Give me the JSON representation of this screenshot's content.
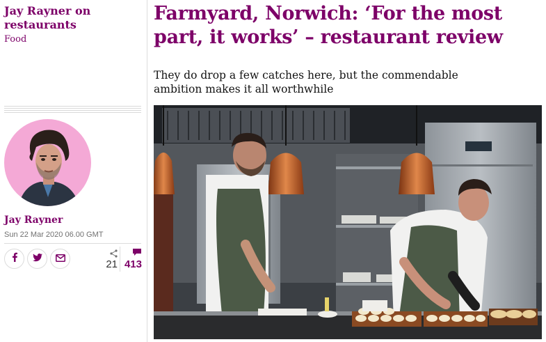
{
  "series": {
    "title": "Jay Rayner on restaurants",
    "section": "Food"
  },
  "byline": {
    "name": "Jay Rayner",
    "date": "Sun 22 Mar 2020 06.00 GMT"
  },
  "share": {
    "facebook_icon": "facebook-icon",
    "twitter_icon": "twitter-icon",
    "email_icon": "email-icon",
    "share_count": "21",
    "comment_count": "413"
  },
  "article": {
    "headline": "Farmyard, Norwich: ‘For the most part, it works’ – restaurant review",
    "standfirst": "They do drop a few catches here, but the commendable ambition makes it all worthwhile"
  },
  "colors": {
    "brand": "#7d0068",
    "avatar_bg": "#f4a9d6"
  }
}
